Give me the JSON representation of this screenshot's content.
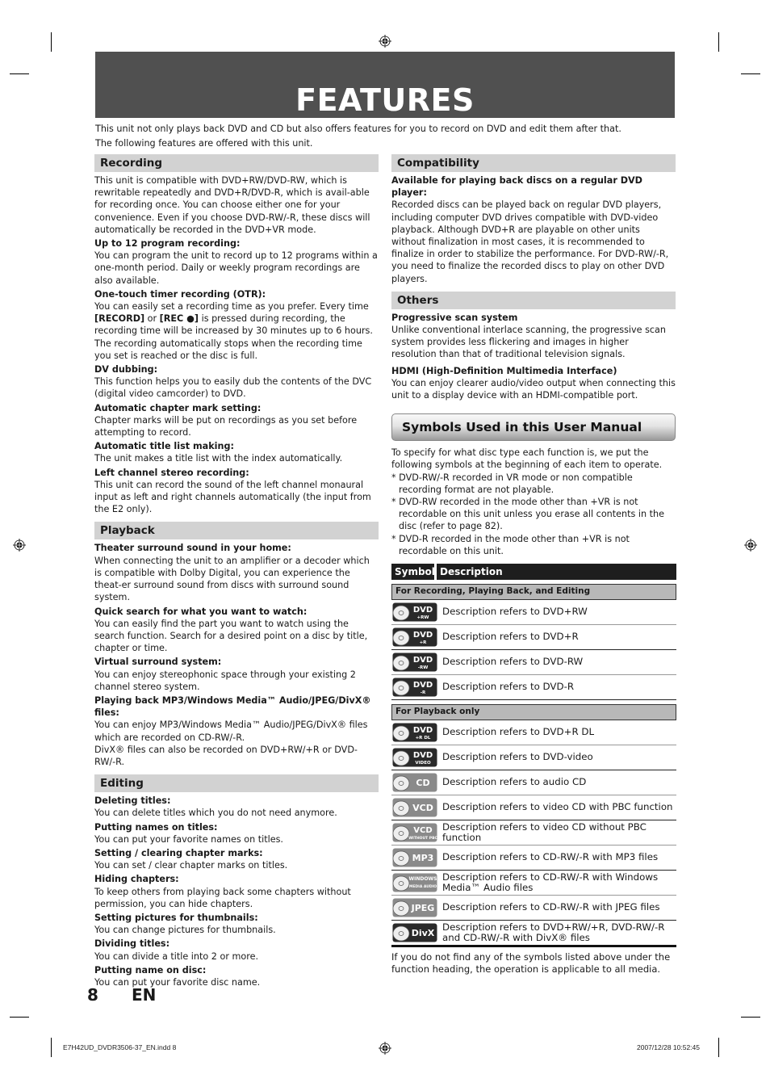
{
  "page": {
    "title": "FEATURES",
    "intro": [
      "This unit not only plays back DVD and CD but also offers features for you to record on DVD and edit them after that.",
      "The following features are offered with this unit."
    ],
    "page_number": "8",
    "language": "EN"
  },
  "recording": {
    "heading": "Recording",
    "intro": "This unit is compatible with DVD+RW/DVD-RW, which is rewritable repeatedly and DVD+R/DVD-R, which is avail-able for recording once. You can choose either one for your convenience. Even if you choose DVD-RW/-R, these discs will automatically be recorded in the DVD+VR mode.",
    "items": [
      {
        "title": "Up to 12 program recording:",
        "text": "You can program the unit to record up to 12 programs within a one-month period. Daily or weekly program recordings are also available."
      },
      {
        "title": "One-touch timer recording (OTR):",
        "text_pre": "You can easily set a recording time as you prefer. Every time ",
        "key1": "[RECORD]",
        "text_mid": " or ",
        "key2": "[REC ●]",
        "text_post": " is pressed during recording, the recording time will be increased by 30 minutes up to 6 hours. The recording automatically stops when the recording time you set is reached or the disc is full."
      },
      {
        "title": "DV dubbing:",
        "text": "This function helps you to easily dub the contents of the DVC (digital video camcorder) to DVD."
      },
      {
        "title": "Automatic chapter mark setting:",
        "text": "Chapter marks will be put on recordings as you set before attempting to record."
      },
      {
        "title": "Automatic title list making:",
        "text": "The unit makes a title list with the index automatically."
      },
      {
        "title": "Left channel stereo recording:",
        "text": "This unit can record the sound of the left channel monaural input as left and right channels automatically (the input from the E2 only)."
      }
    ]
  },
  "playback": {
    "heading": "Playback",
    "items": [
      {
        "title": "Theater surround sound in your home:",
        "text": "When connecting the unit to an amplifier or a decoder which is compatible with Dolby Digital, you can experience the theat-er surround sound from discs with surround sound system."
      },
      {
        "title": "Quick search for what you want to watch:",
        "text": "You can easily find the part you want to watch using the search function. Search for a desired point on a disc by title, chapter or time."
      },
      {
        "title": "Virtual surround system:",
        "text": "You can enjoy stereophonic space through your existing 2 channel stereo system."
      },
      {
        "title": "Playing back MP3/Windows Media™ Audio/JPEG/DivX® files:",
        "text": "You can enjoy MP3/Windows Media™ Audio/JPEG/DivX® files which are recorded on CD-RW/-R.",
        "text2": "DivX® files can also be recorded on DVD+RW/+R or DVD-RW/-R."
      }
    ]
  },
  "editing": {
    "heading": "Editing",
    "items": [
      {
        "title": "Deleting titles:",
        "text": "You can delete titles which you do not need anymore."
      },
      {
        "title": "Putting names on titles:",
        "text": "You can put your favorite names on titles."
      },
      {
        "title": "Setting / clearing chapter marks:",
        "text": "You can set / clear chapter marks on titles."
      },
      {
        "title": "Hiding chapters:",
        "text": "To keep others from playing back some chapters without permission, you can hide chapters."
      },
      {
        "title": "Setting pictures for thumbnails:",
        "text": "You can change pictures for thumbnails."
      },
      {
        "title": "Dividing titles:",
        "text": "You can divide a title into 2 or more."
      },
      {
        "title": "Putting name on disc:",
        "text": "You can put your favorite disc name."
      }
    ]
  },
  "compatibility": {
    "heading": "Compatibility",
    "items": [
      {
        "title": "Available for playing back discs on a regular DVD player:",
        "text": "Recorded discs can be played back on regular DVD players, including computer DVD drives compatible with DVD-video playback. Although DVD+R are playable on other units without finalization in most cases, it is recommended to finalize in order to stabilize the performance. For DVD-RW/-R, you need to finalize the recorded discs to play on other DVD players."
      }
    ]
  },
  "others": {
    "heading": "Others",
    "items": [
      {
        "title": "Progressive scan system",
        "text": "Unlike conventional interlace scanning, the progressive scan system provides less flickering and images in higher resolution than that of traditional television signals."
      },
      {
        "title": "HDMI (High-Definition Multimedia Interface)",
        "text": "You can enjoy clearer audio/video output when connecting this unit to a display device with an HDMI-compatible port."
      }
    ]
  },
  "symbols": {
    "heading": "Symbols Used in this User Manual",
    "intro": "To specify for what disc type each function is, we put the following symbols at the beginning of each item to operate.",
    "notes": [
      "* DVD-RW/-R recorded in VR mode or non compatible recording format are not playable.",
      "* DVD-RW recorded in the mode other than +VR is not recordable on this unit unless you erase all contents in the disc (refer to page 82).",
      "* DVD-R recorded in the mode other than +VR is not recordable on this unit."
    ],
    "table": {
      "col_symbol": "Symbol",
      "col_description": "Description",
      "groups": [
        {
          "label": "For Recording, Playing Back, and Editing",
          "rows": [
            {
              "icon": "dvd-plus-rw-icon",
              "main": "DVD",
              "sub": "+RW",
              "style": "dark",
              "desc": "Description refers to DVD+RW"
            },
            {
              "icon": "dvd-plus-r-icon",
              "main": "DVD",
              "sub": "+R",
              "style": "dark",
              "desc": "Description refers to DVD+R"
            },
            {
              "icon": "dvd-minus-rw-icon",
              "main": "DVD",
              "sub": "-RW",
              "style": "dark",
              "desc": "Description refers to DVD-RW"
            },
            {
              "icon": "dvd-minus-r-icon",
              "main": "DVD",
              "sub": "-R",
              "style": "dark",
              "desc": "Description refers to DVD-R"
            }
          ]
        },
        {
          "label": "For Playback only",
          "rows": [
            {
              "icon": "dvd-plus-r-dl-icon",
              "main": "DVD",
              "sub": "+R DL",
              "style": "dark",
              "desc": "Description refers to DVD+R DL"
            },
            {
              "icon": "dvd-video-icon",
              "main": "DVD",
              "sub": "VIDEO",
              "style": "dark",
              "desc": "Description refers to DVD-video"
            },
            {
              "icon": "audio-cd-icon",
              "main": "CD",
              "sub": "",
              "style": "light",
              "desc": "Description refers to audio CD"
            },
            {
              "icon": "vcd-icon",
              "main": "VCD",
              "sub": "",
              "style": "light",
              "desc": "Description refers to video CD with PBC function"
            },
            {
              "icon": "vcd-without-pbc-icon",
              "main": "VCD",
              "sub": "WITHOUT PBC",
              "style": "light",
              "desc": "Description refers to video CD without PBC function"
            },
            {
              "icon": "mp3-icon",
              "main": "MP3",
              "sub": "",
              "style": "light",
              "desc": "Description refers to CD-RW/-R with MP3 files"
            },
            {
              "icon": "windows-media-audio-icon",
              "main": "WINDOWS",
              "sub": "MEDIA AUDIO",
              "style": "light",
              "desc": "Description refers to CD-RW/-R with Windows Media™ Audio files"
            },
            {
              "icon": "jpeg-icon",
              "main": "JPEG",
              "sub": "",
              "style": "light",
              "desc": "Description refers to CD-RW/-R with JPEG files"
            },
            {
              "icon": "divx-icon",
              "main": "DivX",
              "sub": "",
              "style": "dark",
              "desc": "Description refers to DVD+RW/+R, DVD-RW/-R and CD-RW/-R with DivX® files"
            }
          ]
        }
      ]
    },
    "outro": "If you do not find any of the symbols listed above under the function heading, the operation is applicable to all media."
  },
  "footer": {
    "filename": "E7H42UD_DVDR3506-37_EN.indd   8",
    "timestamp": "2007/12/28   10:52:45"
  },
  "colors": {
    "banner": "#505050",
    "section_heading": "#d2d2d2",
    "table_header": "#1e1e1e",
    "category_row": "#b8b8b8"
  }
}
